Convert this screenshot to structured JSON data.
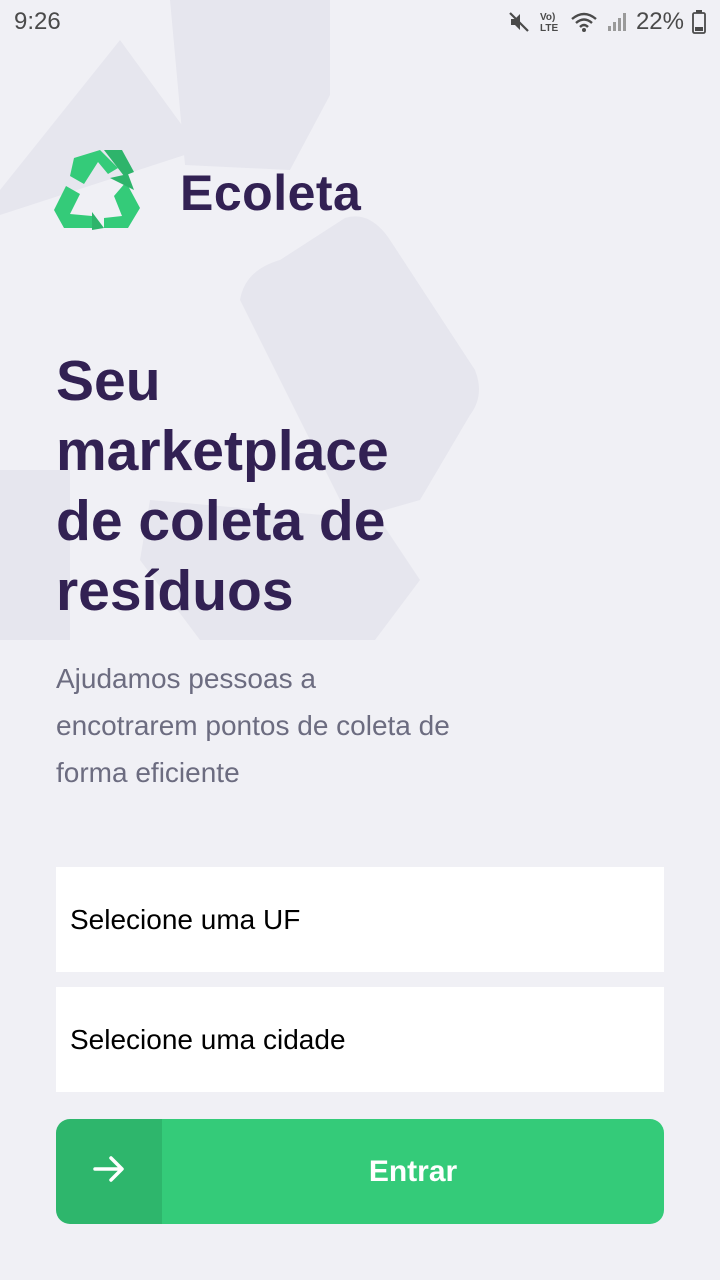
{
  "status_bar": {
    "time": "9:26",
    "battery_percent": "22%",
    "icons": [
      "mute-icon",
      "volte-icon",
      "wifi-icon",
      "signal-icon",
      "battery-icon"
    ]
  },
  "logo": {
    "icon": "recycle-icon",
    "text": "Ecoleta"
  },
  "headline": {
    "line1": "Seu",
    "line2": "marketplace",
    "line3": "de coleta de",
    "line4": "resíduos"
  },
  "subtitle": {
    "line1": "Ajudamos pessoas a",
    "line2": "encotrarem pontos de coleta de",
    "line3": "forma eficiente"
  },
  "form": {
    "uf_select": {
      "value": "Selecione uma UF"
    },
    "city_select": {
      "value": "Selecione uma cidade"
    }
  },
  "enter_button": {
    "label": "Entrar",
    "icon": "arrow-right-icon"
  },
  "colors": {
    "background": "#F0F0F5",
    "title": "#322153",
    "text": "#6C6C80",
    "primary": "#34CB79",
    "field_background": "#FFFFFF"
  }
}
